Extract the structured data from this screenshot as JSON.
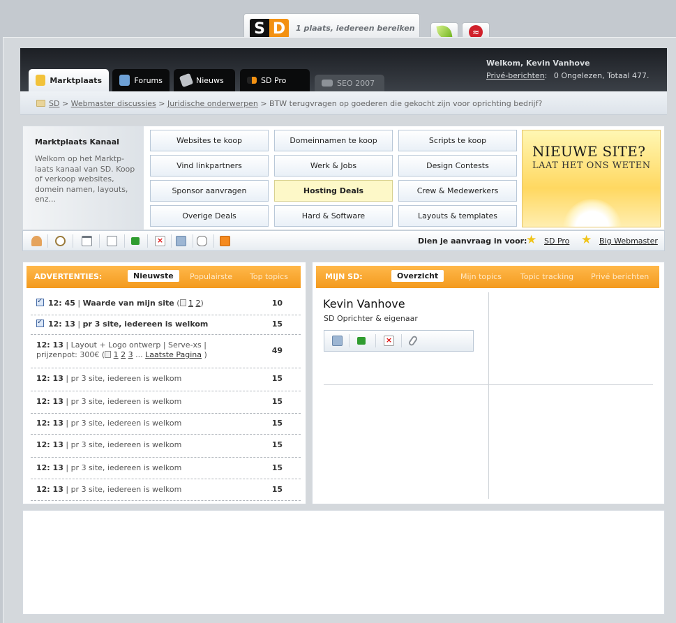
{
  "brand": {
    "s": "S",
    "d": "D",
    "slogan": "1 plaats, iedereen bereiken"
  },
  "user": {
    "welcome": "Welkom, Kevin Vanhove",
    "pm_label": "Privé-berichten",
    "pm_status": "0 Ongelezen, Totaal 477."
  },
  "tabs": [
    {
      "label": "Marktplaats",
      "icon": "users-icon"
    },
    {
      "label": "Forums",
      "icon": "forum-users-icon"
    },
    {
      "label": "Nieuws",
      "icon": "news-tag-icon"
    },
    {
      "label": "SD Pro",
      "icon": "sd-logo-icon"
    },
    {
      "label": "SEO 2007",
      "icon": "keyboard-icon"
    }
  ],
  "breadcrumb": {
    "items": [
      "SD",
      "Webmaster discussies",
      "Juridische onderwerpen"
    ],
    "current": "BTW terugvragen op goederen die gekocht zijn voor oprichting bedrijf?",
    "sep": ">"
  },
  "kanaal": {
    "title": "Marktplaats Kanaal",
    "desc": "Welkom op het Marktp-laats kanaal van SD. Koop of verkoop websites, domein namen, layouts, enz...",
    "categories": [
      "Websites te koop",
      "Domeinnamen te koop",
      "Scripts te koop",
      "Vind linkpartners",
      "Werk & Jobs",
      "Design Contests",
      "Sponsor aanvragen",
      "Hosting Deals",
      "Crew & Medewerkers",
      "Overige Deals",
      "Hard & Software",
      "Layouts & templates"
    ],
    "promo_line1": "NIEUWE SITE?",
    "promo_line2": "LAAT HET ONS WETEN"
  },
  "toolbar": {
    "icons": [
      "user-icon",
      "clock-icon",
      "calendar-icon",
      "search-doc-icon",
      "flag-icon",
      "delete-icon",
      "users-search-icon",
      "chat-icon",
      "rss-icon"
    ],
    "prompt": "Dien je aanvraag in voor:",
    "link1": "SD Pro",
    "link2": "Big Webmaster"
  },
  "ads": {
    "title": "ADVERTENTIES:",
    "tabs": [
      "Nieuwste",
      "Populairste",
      "Top topics"
    ],
    "rows": [
      {
        "time": "12: 45",
        "sep": "|",
        "text": "Waarde van mijn site",
        "pages": [
          "1",
          "2"
        ],
        "count": "10"
      },
      {
        "time": "12: 13",
        "sep": "|",
        "text": "pr 3 site, iedereen is welkom",
        "count": "15"
      },
      {
        "time": "12: 13",
        "sep": "|",
        "text": "Layout + Logo ontwerp | Serve-xs |",
        "text2": "prijzenpot: 300€",
        "pages": [
          "1",
          "2",
          "3"
        ],
        "last": "Laatste Pagina",
        "count": "49"
      },
      {
        "time": "12: 13",
        "sep": "|",
        "text": "pr 3 site, iedereen is welkom",
        "count": "15"
      },
      {
        "time": "12: 13",
        "sep": "|",
        "text": "pr 3 site, iedereen is welkom",
        "count": "15"
      },
      {
        "time": "12: 13",
        "sep": "|",
        "text": "pr 3 site, iedereen is welkom",
        "count": "15"
      },
      {
        "time": "12: 13",
        "sep": "|",
        "text": "pr 3 site, iedereen is welkom",
        "count": "15"
      },
      {
        "time": "12: 13",
        "sep": "|",
        "text": "pr 3 site, iedereen is welkom",
        "count": "15"
      },
      {
        "time": "12: 13",
        "sep": "|",
        "text": "pr 3 site, iedereen is welkom",
        "count": "15"
      }
    ]
  },
  "mysd": {
    "title": "MIJN SD:",
    "tabs": [
      "Overzicht",
      "Mijn topics",
      "Topic tracking",
      "Privé berichten"
    ],
    "name": "Kevin Vanhove",
    "role": "SD Oprichter & eigenaar",
    "tool_icons": [
      "users-search-icon",
      "flag-icon",
      "delete-icon",
      "paperclip-icon"
    ]
  }
}
